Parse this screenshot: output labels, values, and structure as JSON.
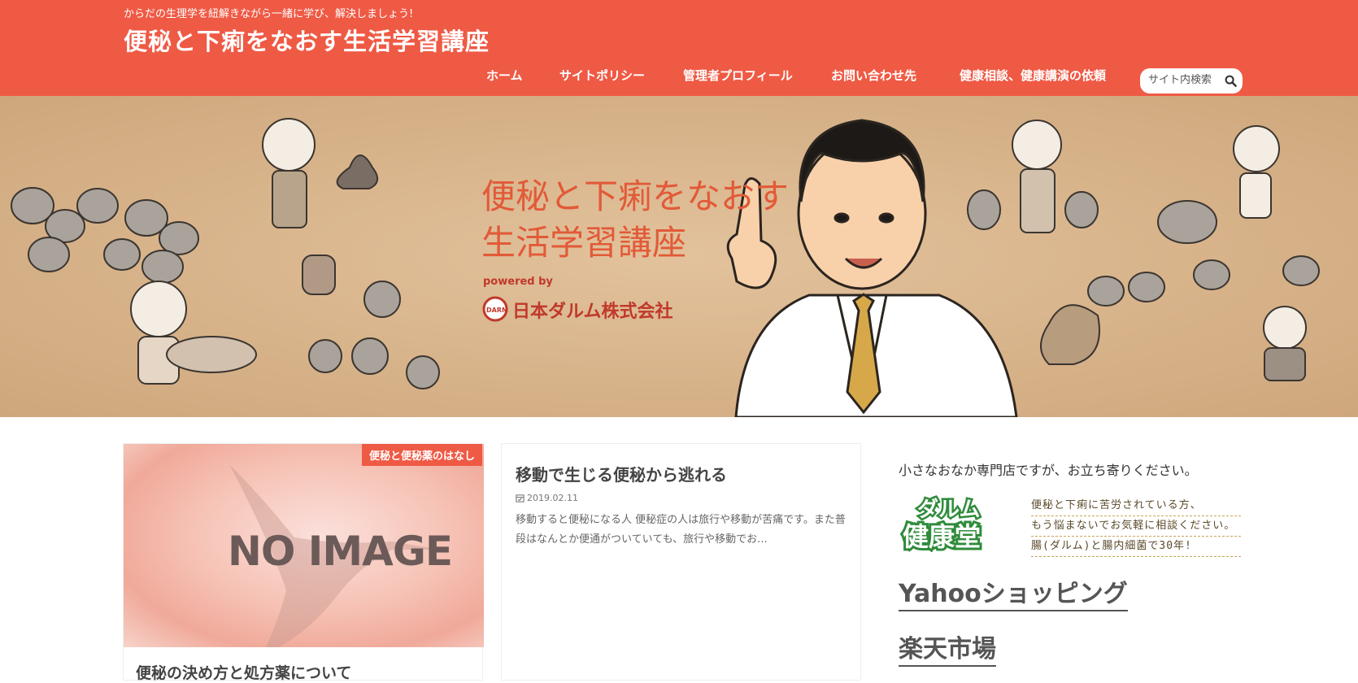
{
  "header": {
    "tagline": "からだの生理学を紐解きながら一緒に学び、解決しましょう!",
    "title": "便秘と下痢をなおす生活学習講座",
    "bg_color": "#ef5a45"
  },
  "nav": {
    "items": [
      {
        "label": "ホーム"
      },
      {
        "label": "サイトポリシー"
      },
      {
        "label": "管理者プロフィール"
      },
      {
        "label": "お問い合わせ先"
      },
      {
        "label": "健康相談、健康講演の依頼"
      }
    ]
  },
  "search": {
    "placeholder": "サイト内検索",
    "icon": "search-icon"
  },
  "hero": {
    "title_line1": "便秘と下痢をなおす",
    "title_line2": "生活学習講座",
    "powered_by": "powered by",
    "company": "日本ダルム株式会社",
    "company_mark": "DARM"
  },
  "posts": [
    {
      "category": "便秘と便秘薬のはなし",
      "thumbnail_text": "NO IMAGE",
      "title": "便秘の決め方と処方薬について"
    },
    {
      "title": "移動で生じる便秘から逃れる",
      "date": "2019.02.11",
      "excerpt": "移動すると便秘になる人 便秘症の人は旅行や移動が苦痛です。また普段はなんとか便通がついていても、旅行や移動でお..."
    }
  ],
  "sidebar": {
    "intro": "小さなおなか専門店ですが、お立ち寄りください。",
    "darm_logo_line1": "ダルム",
    "darm_logo_line2": "健康堂",
    "darm_lines": [
      "便秘と下痢に苦労されている方、",
      "もう悩まないでお気軽に相談ください。",
      "腸(ダルム)と腸内細菌で30年!"
    ],
    "links": [
      "Yahooショッピング",
      "楽天市場"
    ]
  }
}
